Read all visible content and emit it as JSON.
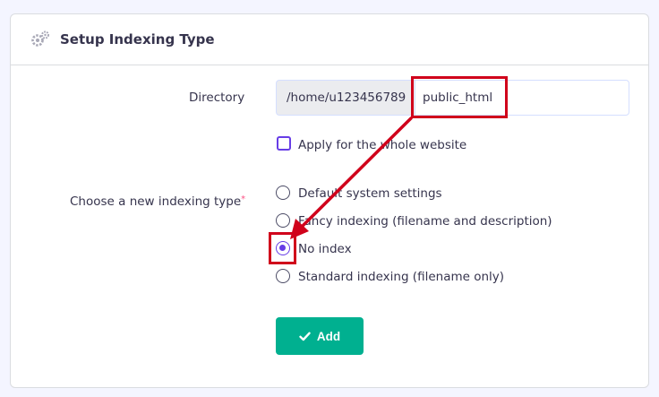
{
  "card": {
    "title": "Setup Indexing Type",
    "header_icon": "gears-icon"
  },
  "directory": {
    "label": "Directory",
    "prefix": "/home/u123456789",
    "value": "public_html"
  },
  "apply_whole_site": {
    "label": "Apply for the whole website",
    "checked": false
  },
  "indexing": {
    "label": "Choose a new indexing type",
    "required_marker": "*",
    "options": [
      {
        "label": "Default system settings",
        "checked": false
      },
      {
        "label": "Fancy indexing (filename and description)",
        "checked": false
      },
      {
        "label": "No index",
        "checked": true
      },
      {
        "label": "Standard indexing (filename only)",
        "checked": false
      }
    ]
  },
  "add_button": {
    "label": "Add",
    "icon": "check-icon"
  },
  "colors": {
    "accent": "#673de6",
    "button": "#00b090",
    "annotation": "#d0021b"
  }
}
